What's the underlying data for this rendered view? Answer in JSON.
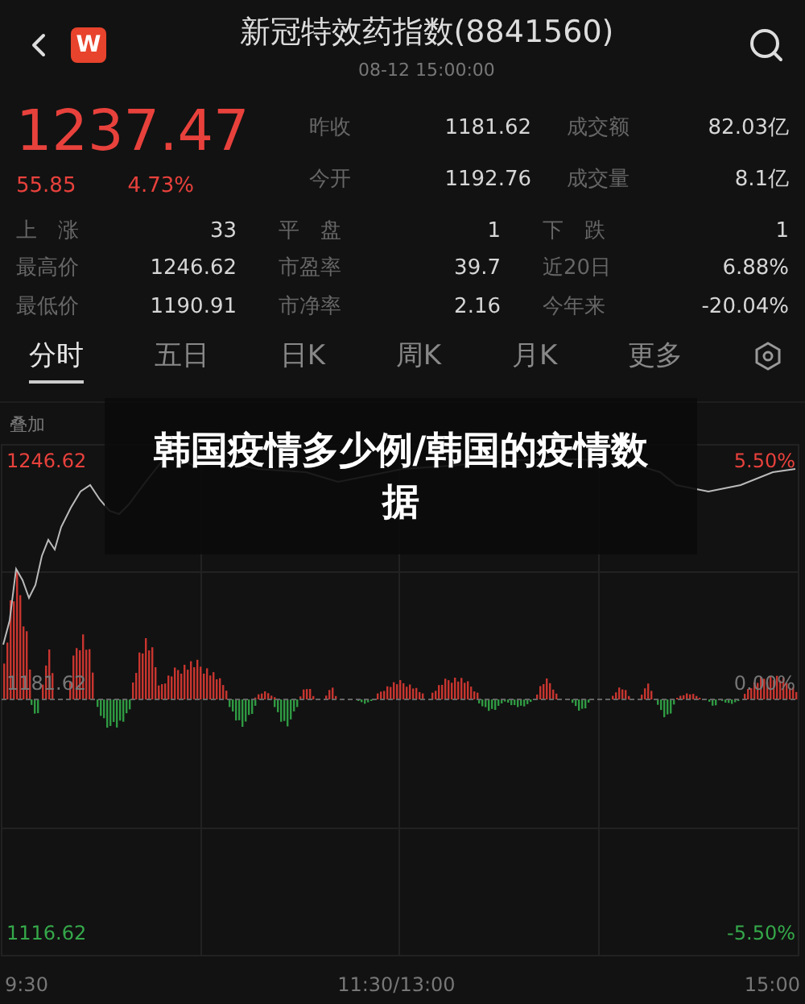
{
  "header": {
    "logo": "W",
    "title": "新冠特效药指数(8841560)",
    "timestamp": "08-12 15:00:00"
  },
  "quote": {
    "price": "1237.47",
    "change": "55.85",
    "change_pct": "4.73%"
  },
  "top_stats": [
    [
      {
        "label": "昨收",
        "value": "1181.62"
      },
      {
        "label": "成交额",
        "value": "82.03亿"
      }
    ],
    [
      {
        "label": "今开",
        "value": "1192.76"
      },
      {
        "label": "成交量",
        "value": "8.1亿"
      }
    ]
  ],
  "grid_stats": [
    [
      {
        "label": "上　涨",
        "value": "33"
      },
      {
        "label": "平　盘",
        "value": "1"
      },
      {
        "label": "下　跌",
        "value": "1"
      }
    ],
    [
      {
        "label": "最高价",
        "value": "1246.62"
      },
      {
        "label": "市盈率",
        "value": "39.7"
      },
      {
        "label": "近20日",
        "value": "6.88%"
      }
    ],
    [
      {
        "label": "最低价",
        "value": "1190.91"
      },
      {
        "label": "市净率",
        "value": "2.16"
      },
      {
        "label": "今年来",
        "value": "-20.04%"
      }
    ]
  ],
  "tabs": [
    {
      "label": "分时",
      "selected": true
    },
    {
      "label": "五日",
      "selected": false
    },
    {
      "label": "日K",
      "selected": false
    },
    {
      "label": "周K",
      "selected": false
    },
    {
      "label": "月K",
      "selected": false
    },
    {
      "label": "更多",
      "selected": false
    }
  ],
  "chart": {
    "overlay_label": "叠加",
    "high": "1246.62",
    "high_pct": "5.50%",
    "mid": "1181.62",
    "mid_pct": "0.00%",
    "low": "1116.62",
    "low_pct": "-5.50%",
    "x_labels": [
      "9:30",
      "11:30/13:00",
      "15:00"
    ]
  },
  "banner": {
    "text": "韩国疫情多少例/韩国的疫情数据"
  }
}
